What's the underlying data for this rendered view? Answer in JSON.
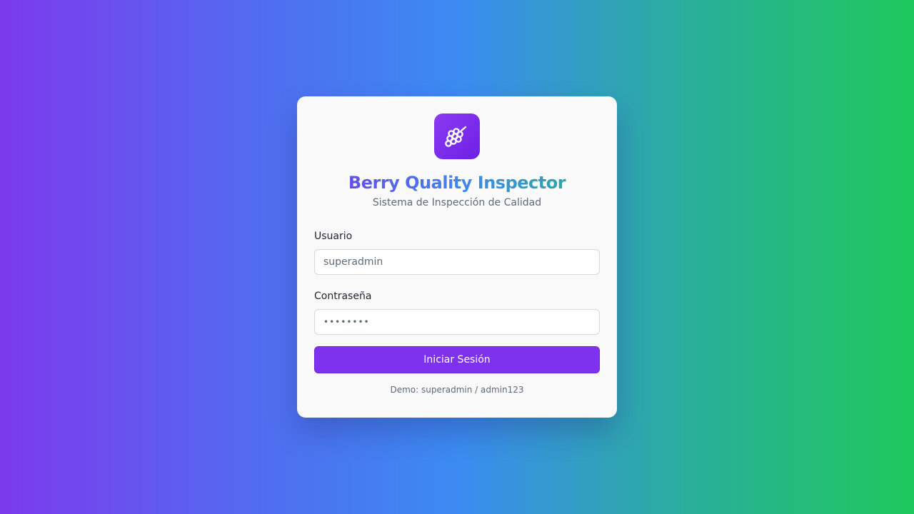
{
  "app": {
    "logo_icon": "grapes-icon",
    "title": "Berry Quality Inspector",
    "subtitle": "Sistema de Inspección de Calidad"
  },
  "form": {
    "username_label": "Usuario",
    "username_value": "superadmin",
    "password_label": "Contraseña",
    "password_value": "admin123",
    "submit_label": "Iniciar Sesión"
  },
  "demo_hint": "Demo: superadmin / admin123",
  "colors": {
    "accent": "#7e32ee",
    "gradient_start": "#7c3aed",
    "gradient_mid": "#3b8bf2",
    "gradient_end": "#1ec85c"
  }
}
